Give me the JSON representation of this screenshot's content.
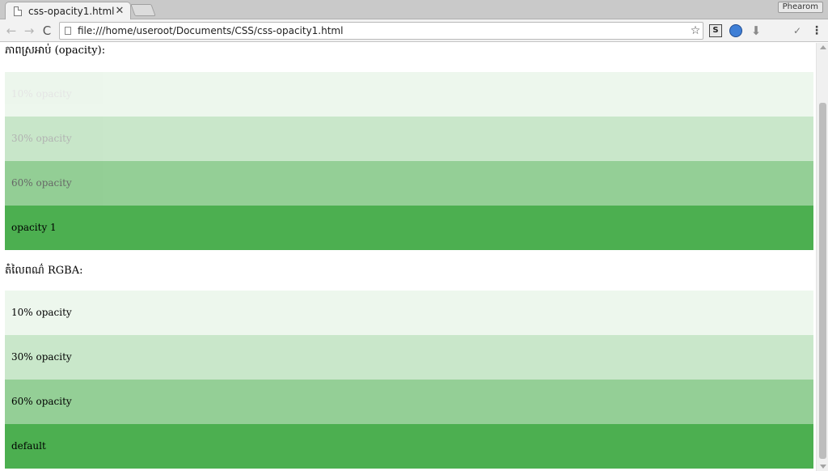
{
  "browser": {
    "tab_title": "css-opacity1.html",
    "tab_close": "✕",
    "profile_name": "Phearom",
    "url": "file:///home/useroot/Documents/CSS/css-opacity1.html",
    "back_icon": "←",
    "forward_icon": "→",
    "reload_icon": "C",
    "star_icon": "☆",
    "ext_s_label": "S",
    "ext_down_icon": "⬇",
    "ext_check_icon": "✓",
    "menu_icon": "⋮"
  },
  "page": {
    "opacity_heading": "ភាពស្រអាប់ (opacity):",
    "opacity_rows": [
      {
        "label": "10% opacity",
        "opacity": 0.1
      },
      {
        "label": "30% opacity",
        "opacity": 0.3
      },
      {
        "label": "60% opacity",
        "opacity": 0.6
      },
      {
        "label": "opacity 1",
        "opacity": 1
      }
    ],
    "rgba_heading": "តំលៃពណ៌ RGBA:",
    "rgba_rows": [
      {
        "label": "10% opacity",
        "alpha": 0.1
      },
      {
        "label": "30% opacity",
        "alpha": 0.3
      },
      {
        "label": "60% opacity",
        "alpha": 0.6
      },
      {
        "label": "default",
        "alpha": 1
      }
    ]
  },
  "colors": {
    "base_green": "#4CAF50",
    "rgb_green": "76, 175, 80"
  }
}
